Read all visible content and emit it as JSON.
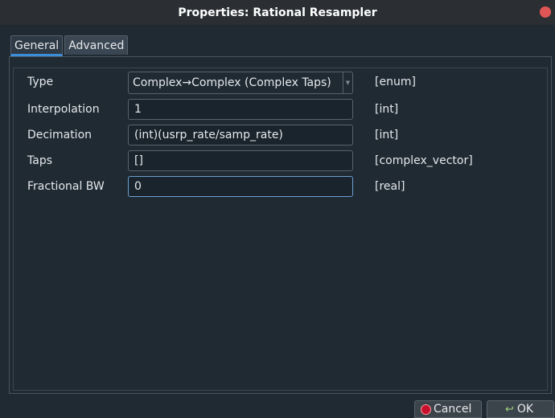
{
  "window": {
    "title": "Properties: Rational Resampler"
  },
  "tabs": [
    {
      "label": "General",
      "active": true
    },
    {
      "label": "Advanced",
      "active": false
    }
  ],
  "rows": [
    {
      "label": "Type",
      "value": "Complex→Complex (Complex Taps)",
      "type": "[enum]",
      "widget": "combo"
    },
    {
      "label": "Interpolation",
      "value": "1",
      "type": "[int]",
      "widget": "input"
    },
    {
      "label": "Decimation",
      "value": "(int)(usrp_rate/samp_rate)",
      "type": "[int]",
      "widget": "input"
    },
    {
      "label": "Taps",
      "value": "[]",
      "type": "[complex_vector]",
      "widget": "input"
    },
    {
      "label": "Fractional BW",
      "value": "0",
      "type": "[real]",
      "widget": "input",
      "focused": true
    }
  ],
  "buttons": {
    "cancel_label": "Cancel",
    "ok_label": "OK"
  },
  "icons": {
    "close": "close-icon",
    "cancel": "cancel-icon",
    "ok": "ok-icon",
    "dropdown": "chevron-down-icon"
  },
  "colors": {
    "accent": "#3d8ed8",
    "close": "#e05555",
    "cancel_icon": "#c8102e"
  }
}
